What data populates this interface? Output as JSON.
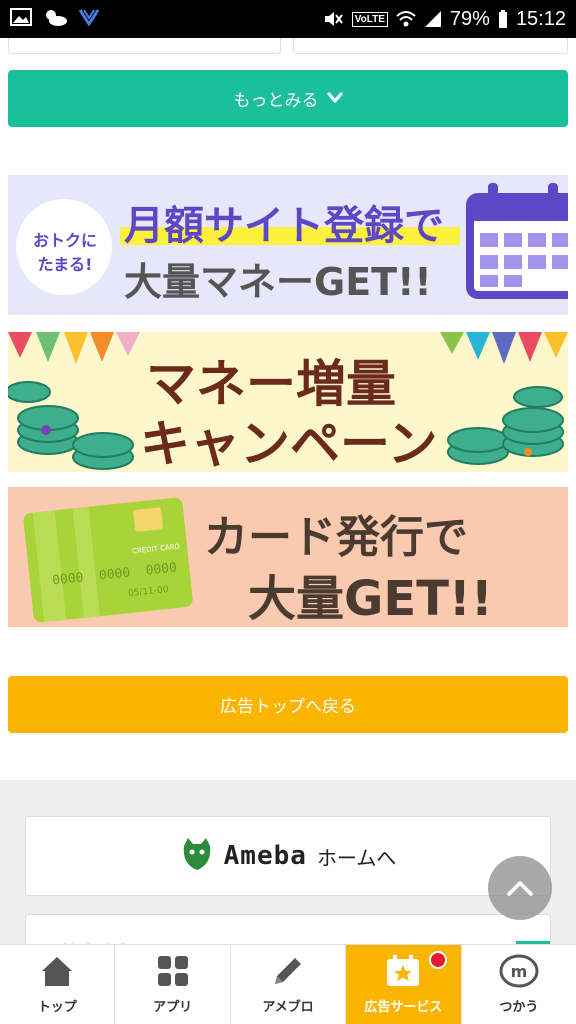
{
  "status_bar": {
    "battery": "79%",
    "time": "15:12",
    "volte": "VoLTE"
  },
  "more_button": {
    "label": "もっとみる"
  },
  "banners": [
    {
      "badge_line1": "おトクに",
      "badge_line2": "たまる!",
      "title_line1": "月額サイト登録で",
      "title_line2": "大量マネーGET!!"
    },
    {
      "title_line1": "マネー増量",
      "title_line2": "キャンペーン"
    },
    {
      "card_brand": "CREDIT CARD",
      "card_number": "0000  0000  0000",
      "card_expiry": "05/11-00",
      "title_line1": "カード発行で",
      "title_line2": "大量GET!!"
    }
  ],
  "ad_top_button": {
    "label": "広告トップへ戻る"
  },
  "ameba": {
    "logo": "Ameba",
    "home": "ホームへ"
  },
  "money_logo": "money",
  "tabs": [
    {
      "label": "トップ",
      "icon": "home-icon"
    },
    {
      "label": "アプリ",
      "icon": "apps-grid-icon"
    },
    {
      "label": "アメブロ",
      "icon": "pencil-icon"
    },
    {
      "label": "広告サービス",
      "icon": "star-calendar-icon",
      "active": true
    },
    {
      "label": "つかう",
      "icon": "money-coin-icon"
    }
  ],
  "colors": {
    "accent_green": "#1cbf9c",
    "accent_yellow": "#fbb400",
    "badge_red": "#e8192c"
  }
}
